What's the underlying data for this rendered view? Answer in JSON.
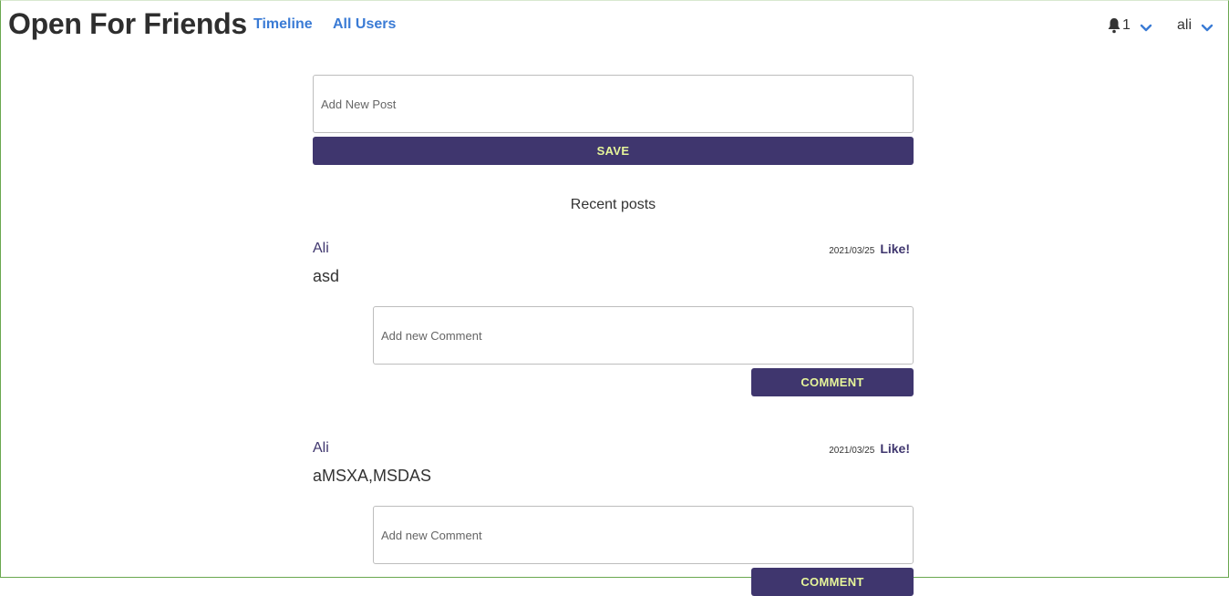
{
  "app": {
    "brand": "Open For Friends"
  },
  "nav": {
    "timeline": "Timeline",
    "all_users": "All Users"
  },
  "notifications": {
    "count": "1",
    "icon": "bell-icon"
  },
  "user_menu": {
    "name": "ali"
  },
  "composer": {
    "placeholder": "Add New Post",
    "save_label": "SAVE"
  },
  "recent": {
    "title": "Recent posts"
  },
  "posts": [
    {
      "author": "Ali",
      "date": "2021/03/25",
      "like_label": "Like!",
      "body": "asd",
      "comment_placeholder": "Add new Comment",
      "comment_label": "COMMENT"
    },
    {
      "author": "Ali",
      "date": "2021/03/25",
      "like_label": "Like!",
      "body": "aMSXA,MSDAS",
      "comment_placeholder": "Add new Comment",
      "comment_label": "COMMENT"
    }
  ],
  "colors": {
    "brand_text": "#2e2e2e",
    "link": "#3a7bd5",
    "primary": "#3f366e",
    "button_text": "#e6f59a"
  }
}
